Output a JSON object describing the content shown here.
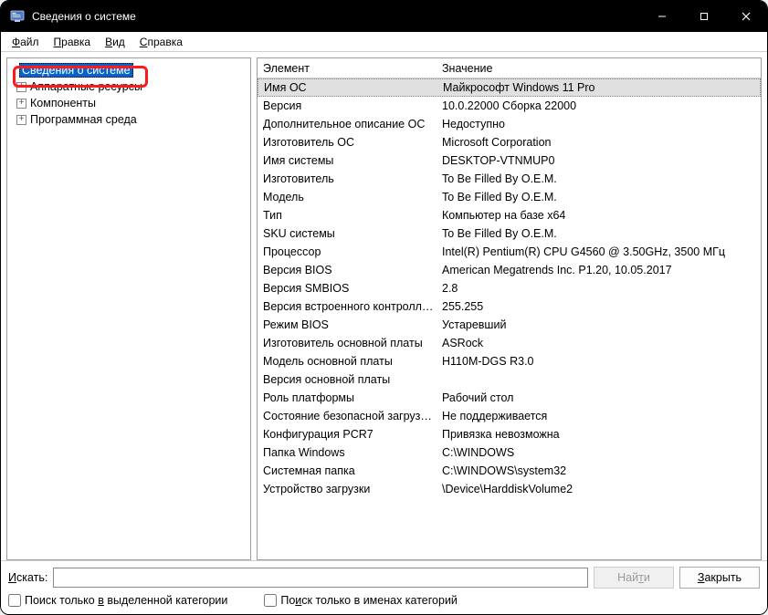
{
  "titlebar": {
    "title": "Сведения о системе"
  },
  "menubar": {
    "file": {
      "label": "Файл",
      "hot": "Ф"
    },
    "edit": {
      "label": "Правка",
      "hot": "П"
    },
    "view": {
      "label": "Вид",
      "hot": "В"
    },
    "help": {
      "label": "Справка",
      "hot": "С"
    }
  },
  "tree": {
    "root": "Сведения о системе",
    "children": [
      "Аппаратные ресурсы",
      "Компоненты",
      "Программная среда"
    ]
  },
  "table": {
    "headers": {
      "element": "Элемент",
      "value": "Значение"
    },
    "rows": [
      {
        "el": "Имя ОС",
        "val": "Майкрософт Windows 11 Pro",
        "sel": true
      },
      {
        "el": "Версия",
        "val": "10.0.22000 Сборка 22000"
      },
      {
        "el": "Дополнительное описание ОС",
        "val": "Недоступно"
      },
      {
        "el": "Изготовитель ОС",
        "val": "Microsoft Corporation"
      },
      {
        "el": "Имя системы",
        "val": "DESKTOP-VTNMUP0"
      },
      {
        "el": "Изготовитель",
        "val": "To Be Filled By O.E.M."
      },
      {
        "el": "Модель",
        "val": "To Be Filled By O.E.M."
      },
      {
        "el": "Тип",
        "val": "Компьютер на базе x64"
      },
      {
        "el": "SKU системы",
        "val": "To Be Filled By O.E.M."
      },
      {
        "el": "Процессор",
        "val": "Intel(R) Pentium(R) CPU G4560 @ 3.50GHz, 3500 МГц"
      },
      {
        "el": "Версия BIOS",
        "val": "American Megatrends Inc. P1.20, 10.05.2017"
      },
      {
        "el": "Версия SMBIOS",
        "val": "2.8"
      },
      {
        "el": "Версия встроенного контролл…",
        "val": "255.255"
      },
      {
        "el": "Режим BIOS",
        "val": "Устаревший"
      },
      {
        "el": "Изготовитель основной платы",
        "val": "ASRock"
      },
      {
        "el": "Модель основной платы",
        "val": "H110M-DGS R3.0"
      },
      {
        "el": "Версия основной платы",
        "val": ""
      },
      {
        "el": "Роль платформы",
        "val": "Рабочий стол"
      },
      {
        "el": "Состояние безопасной загруз…",
        "val": "Не поддерживается"
      },
      {
        "el": "Конфигурация PCR7",
        "val": "Привязка невозможна"
      },
      {
        "el": "Папка Windows",
        "val": "C:\\WINDOWS"
      },
      {
        "el": "Системная папка",
        "val": "C:\\WINDOWS\\system32"
      },
      {
        "el": "Устройство загрузки",
        "val": "\\Device\\HarddiskVolume2"
      }
    ]
  },
  "search": {
    "label": "Искать:",
    "hot": "И",
    "value": "",
    "find": "Найти",
    "find_hot": "т",
    "close": "Закрыть",
    "close_hot": "З"
  },
  "checks": {
    "in_selected": "Поиск только в выделенной категории",
    "in_selected_hot": "в",
    "in_names": "Поиск только в именах категорий",
    "in_names_hot": "и"
  }
}
